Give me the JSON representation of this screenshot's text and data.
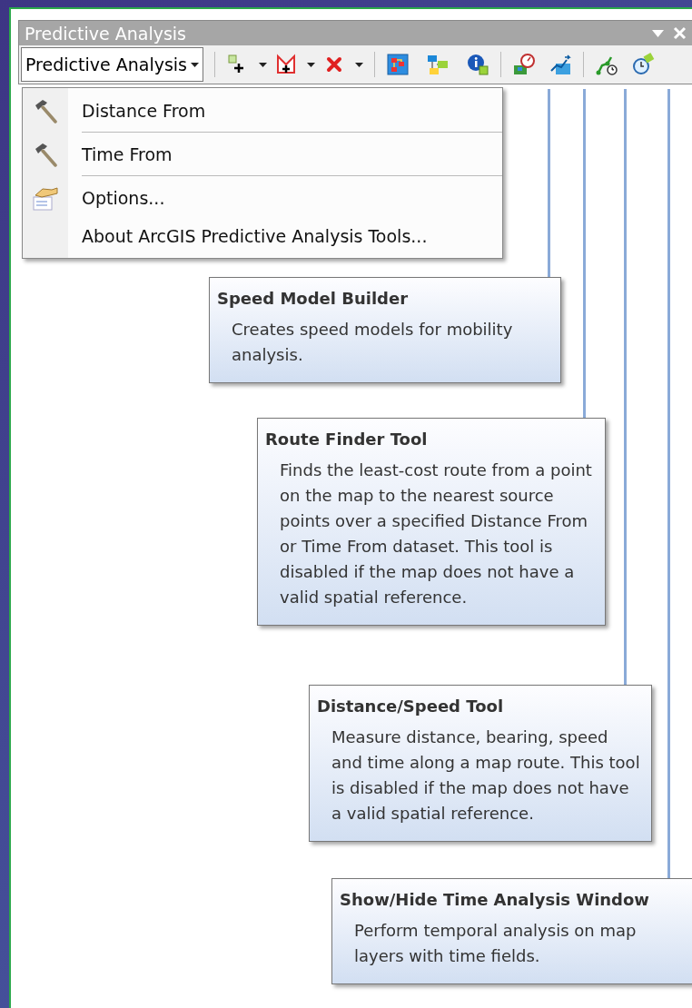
{
  "window": {
    "title": "Predictive Analysis"
  },
  "toolbar": {
    "dropdown": {
      "label": "Predictive Analysis"
    }
  },
  "menu": {
    "items": [
      {
        "label": "Distance From",
        "kind": "tool"
      },
      {
        "label": "Time From",
        "kind": "tool"
      },
      {
        "label": "Options...",
        "kind": "options"
      },
      {
        "label": "About ArcGIS Predictive Analysis Tools...",
        "kind": "plain"
      }
    ]
  },
  "tooltips": [
    {
      "title": "Speed Model Builder",
      "description": "Creates speed models for mobility analysis."
    },
    {
      "title": "Route Finder Tool",
      "description": "Finds the least-cost route from a point on the map to the nearest source points over a specified Distance From or Time From dataset. This tool is disabled if the map does not have a valid spatial reference."
    },
    {
      "title": "Distance/Speed Tool",
      "description": "Measure distance, bearing, speed and time along a map route. This tool is disabled if the map does not have a valid spatial reference."
    },
    {
      "title": "Show/Hide Time Analysis Window",
      "description": "Perform temporal analysis on map layers with time fields."
    }
  ]
}
